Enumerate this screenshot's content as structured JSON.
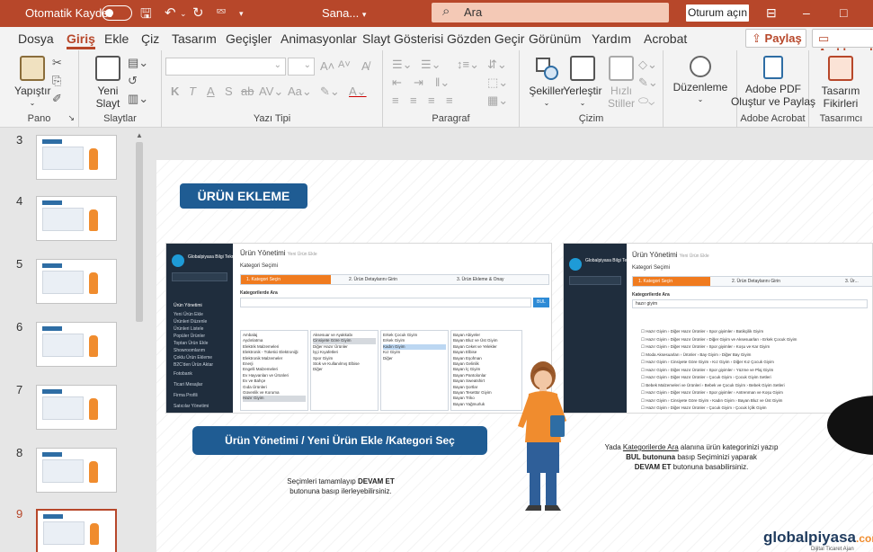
{
  "titlebar": {
    "autosave_label": "Otomatik Kaydet",
    "doc_name": "Sana...",
    "search_placeholder": "Ara",
    "signin_label": "Oturum açın",
    "accent": "#b7472a"
  },
  "tabs": [
    {
      "label": "Dosya"
    },
    {
      "label": "Giriş",
      "active": true
    },
    {
      "label": "Ekle"
    },
    {
      "label": "Çiz"
    },
    {
      "label": "Tasarım"
    },
    {
      "label": "Geçişler"
    },
    {
      "label": "Animasyonlar"
    },
    {
      "label": "Slayt Gösterisi"
    },
    {
      "label": "Gözden Geçir"
    },
    {
      "label": "Görünüm"
    },
    {
      "label": "Yardım"
    },
    {
      "label": "Acrobat"
    }
  ],
  "share_label": "Paylaş",
  "comments_label": "Açıklamalar",
  "ribbon": {
    "groups": {
      "pano": "Pano",
      "slaytlar": "Slaytlar",
      "yazi_tipi": "Yazı Tipi",
      "paragraf": "Paragraf",
      "cizim": "Çizim",
      "adobe_acrobat": "Adobe Acrobat",
      "tasarimci": "Tasarımcı"
    },
    "yapistir": "Yapıştır",
    "yeni_slayt_1": "Yeni",
    "yeni_slayt_2": "Slayt",
    "sekiller": "Şekiller",
    "yerlestir": "Yerleştir",
    "hizli_1": "Hızlı",
    "hizli_2": "Stiller",
    "duzenleme": "Düzenleme",
    "adobe_1": "Adobe PDF",
    "adobe_2": "Oluştur ve Paylaş",
    "tasarim_1": "Tasarım",
    "tasarim_2": "Fikirleri"
  },
  "slides": [
    {
      "num": "3"
    },
    {
      "num": "4"
    },
    {
      "num": "5"
    },
    {
      "num": "6"
    },
    {
      "num": "7"
    },
    {
      "num": "8"
    },
    {
      "num": "9",
      "selected": true
    }
  ],
  "slide": {
    "title": "ÜRÜN EKLEME",
    "banner": "Ürün Yönetimi / Yeni Ürün Ekle /Kategori Seç",
    "left_caption_plain": "Seçimleri tamamlayıp ",
    "left_caption_bold": "DEVAM ET",
    "left_caption_2": "butonuna basıp ilerleyebilirsiniz.",
    "right_caption_1a": "Yada ",
    "right_caption_1b": "Kategorilerde Ara",
    "right_caption_1c": " alanına ürün kategorinizi yazıp",
    "right_caption_2a": "BUL butonuna",
    "right_caption_2b": " basıp Seçiminizi yaparak",
    "right_caption_3a": "DEVAM ET",
    "right_caption_3b": " butonuna basabilirsiniz.",
    "logo_main": "globalpiyasa",
    "logo_tld": ".com",
    "logo_sub": "Dijital Ticaret Ajan",
    "left_shot": {
      "header": "Ürün Yönetimi",
      "header_sub": "Yeni Ürün Ekle",
      "subheader": "Kategori Seçimi",
      "brand": "Globalpiyasa Bilgi Tekn...",
      "steps": [
        "1. Kategori Seçin",
        "2. Ürün Detaylarını Girin",
        "3. Ürün Ekleme & Onay"
      ],
      "search_label": "Kategorilerde Ara",
      "find_button": "BUL",
      "menu": [
        "Ürün Yönetimi",
        "Yeni Ürün Ekle",
        "Ürünleri Düzenle",
        "Ürünleri Listele",
        "Popüler Ürünler",
        "Toptan Ürün Ekle",
        "Showroomlarım",
        "Çoklu Ürün Ekleme",
        "B2C'den Ürün Aktar",
        "Fotobank",
        "Ticari Mesajlar",
        "Firma Profili",
        "Satıcılar Yönetimi"
      ],
      "col1": [
        "Ambalaj",
        "Aydınlatma",
        "Elektrik Malzemeleri",
        "Elektronik - Tüketici Elektroniği",
        "Elektronik Malzemeler",
        "Enerji",
        "Engelli Malzemeleri",
        "Ev Hayvanları ve Ürünleri",
        "Ev ve Bahçe",
        "Gıda Ürünleri",
        "Güvenlik ve Koruma",
        "Hazır Giyim"
      ],
      "col2": [
        "Aksesuar ve Ayakkabı",
        "Cinsiyete Göre Giyim",
        "Diğer Hazır Ürünler",
        "İşçi Kıyafetleri",
        "Spor Giyim",
        "Stok ve Kullanılmış Elbise",
        "Diğer"
      ],
      "col3": [
        "Erkek Çocuk Giyim",
        "Erkek Giyim",
        "Kadın Giyim",
        "Kız Giyim",
        "Diğer"
      ],
      "col4": [
        "Bayan Abiyeler",
        "Bayan Bluz ve Üst Giyim",
        "Bayan Ceket ve Yelekler",
        "Bayan Elbise",
        "Bayan Eşofman",
        "Bayan Gelinlik",
        "Bayan İç Giyim",
        "Bayan Pantolonlar",
        "Bayan Sweatshirt",
        "Bayan Şortlar",
        "Bayan Tesettür Giyim",
        "Bayan Triko",
        "Bayan Yağmurluk"
      ]
    },
    "right_shot": {
      "header": "Ürün Yönetimi",
      "header_sub": "Yeni Ürün Ekle",
      "subheader": "Kategori Seçimi",
      "brand": "Globalpiyasa Bilgi Tekn...",
      "steps": [
        "1. Kategori Seçin",
        "2. Ürün Detaylarını Girin",
        "3. Ür..."
      ],
      "search_label": "Kategorilerde Ara",
      "search_value": "hazır giyim",
      "results": [
        "Hazır Giyim › Diğer Hazır Ürünler › Spor giyimler › Batikçilik Giyim",
        "Hazır Giyim › Diğer Hazır Ürünler › Diğer Giyim ve Aksesuarları › Erkek Çocuk Giyim",
        "Hazır Giyim › Diğer Hazır Ürünler › Spor giyimler › Koşu ve Kar Giyim",
        "Moda Aksesuarları › Ürünler › Bay Giyim › Diğer Bay Giyim",
        "Hazır Giyim › Cinsiyete Göre Giyim › Kız Giyim › Diğer Kız Çocuk Giyim",
        "Hazır Giyim › Diğer Hazır Ürünler › Spor giyimler › Yüzme ve Plaj Giyim",
        "Hazır Giyim › Diğer Hazır Ürünler › Çocuk Giyim › Çocuk Giyim Setleri",
        "Bebek Malzemeleri ve Ürünleri › Bebek ve Çocuk Giyim › Bebek Giyim Setleri",
        "Hazır Giyim › Diğer Hazır Ürünler › Spor giyimler › Antrenman ve Koşu Giyim",
        "Hazır Giyim › Cinsiyete Göre Giyim › Kadın Giyim › Bayan Bluz ve Üst Giyim",
        "Hazır Giyim › Diğer Hazır Ürünler › Çocuk Giyim › Çocuk İçlik Giyim"
      ]
    }
  }
}
